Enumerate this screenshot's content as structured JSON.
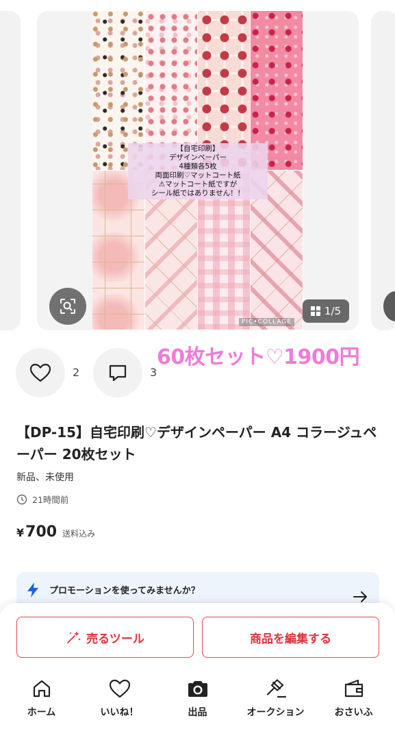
{
  "carousel": {
    "image_label_lines": [
      "【自宅印刷】",
      "デザインペーパー",
      "4種類各5枚",
      "両面印刷♡マットコート紙",
      "⚠マットコート紙ですが",
      "シール紙ではありません！！"
    ],
    "watermark": "PIC•COLLAGE",
    "counter": "1/5"
  },
  "actions": {
    "like_count": "2",
    "comment_count": "3",
    "promo_overlay": "60枚セット♡1900円"
  },
  "product": {
    "title": "【DP-15】自宅印刷♡デザインペーパー A4 コラージュペーパー 20枚セット",
    "condition": "新品、未使用",
    "posted": "21時間前",
    "price_symbol": "¥",
    "price": "700",
    "shipping": "送料込み"
  },
  "promotion": {
    "text": "プロモーションを使ってみませんか？"
  },
  "buttons": {
    "sell_tools": "売るツール",
    "edit_item": "商品を編集する"
  },
  "nav": [
    {
      "label": "ホーム",
      "icon": "home-icon"
    },
    {
      "label": "いいね！",
      "icon": "heart-icon"
    },
    {
      "label": "出品",
      "icon": "camera-icon"
    },
    {
      "label": "オークション",
      "icon": "gavel-icon"
    },
    {
      "label": "おさいふ",
      "icon": "wallet-icon"
    }
  ],
  "colors": {
    "accent_red": "#e0323c",
    "promo_pink": "#f07bd6",
    "banner_bg": "#eef4fb",
    "bolt_blue": "#1565d8"
  }
}
